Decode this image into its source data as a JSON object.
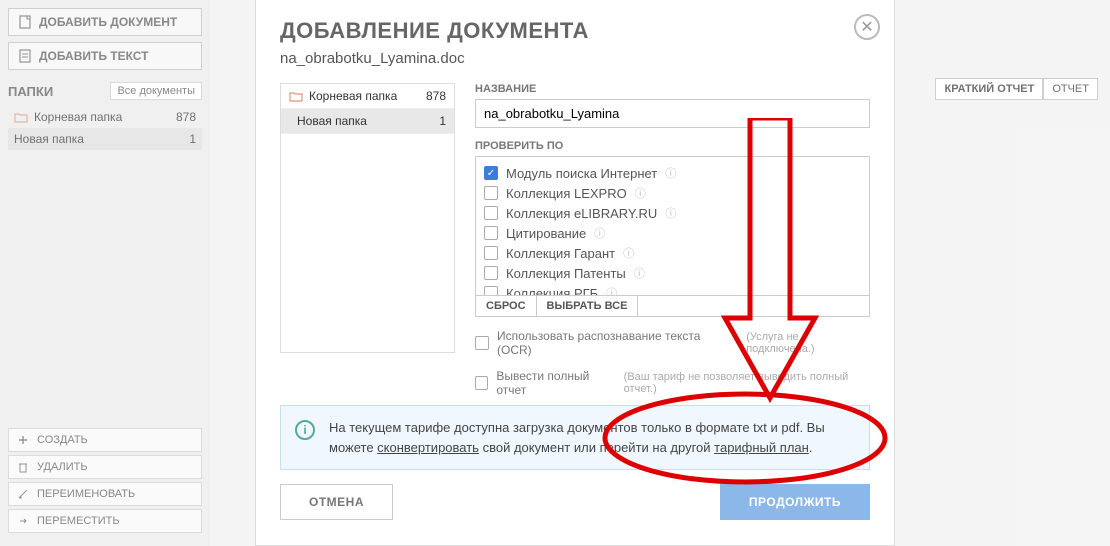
{
  "sidebar": {
    "add_doc": "ДОБАВИТЬ ДОКУМЕНТ",
    "add_text": "ДОБАВИТЬ ТЕКСТ",
    "folders_label": "ПАПКИ",
    "all_docs": "Все документы",
    "folders": [
      {
        "name": "Корневая папка",
        "count": "878"
      },
      {
        "name": "Новая папка",
        "count": "1"
      }
    ],
    "bottom": {
      "create": "СОЗДАТЬ",
      "delete": "УДАЛИТЬ",
      "rename": "ПЕРЕИМЕНОВАТЬ",
      "move": "ПЕРЕМЕСТИТЬ"
    }
  },
  "bg_right": {
    "tab_short": "КРАТКИЙ ОТЧЕТ",
    "tab_report": "ОТЧЕТ"
  },
  "modal": {
    "title": "ДОБАВЛЕНИЕ ДОКУМЕНТА",
    "subtitle": "na_obrabotku_Lyamina.doc",
    "tree": {
      "root": {
        "name": "Корневая папка",
        "count": "878"
      },
      "child": {
        "name": "Новая папка",
        "count": "1"
      }
    },
    "name_label": "НАЗВАНИЕ",
    "name_value": "na_obrabotku_Lyamina",
    "check_label": "ПРОВЕРИТЬ ПО",
    "checks": [
      {
        "label": "Модуль поиска Интернет",
        "checked": true
      },
      {
        "label": "Коллекция LEXPRO",
        "checked": false
      },
      {
        "label": "Коллекция eLIBRARY.RU",
        "checked": false
      },
      {
        "label": "Цитирование",
        "checked": false
      },
      {
        "label": "Коллекция Гарант",
        "checked": false
      },
      {
        "label": "Коллекция Патенты",
        "checked": false
      },
      {
        "label": "Коллекция РГБ",
        "checked": false
      }
    ],
    "reset": "СБРОС",
    "select_all": "ВЫБРАТЬ ВСЕ",
    "ocr_label": "Использовать распознавание текста (OCR)",
    "ocr_note": "(Услуга не подключена.)",
    "full_label": "Вывести полный отчет",
    "full_note": "(Ваш тариф не позволяет выводить полный отчет.)",
    "info_text_1": "На текущем тарифе доступна загрузка документов только в формате txt и pdf. Вы можете ",
    "info_link_1": "сконвертировать",
    "info_text_2": " свой документ или перейти на другой ",
    "info_link_2": "тарифный план",
    "info_text_3": ".",
    "cancel": "ОТМЕНА",
    "continue": "ПРОДОЛЖИТЬ"
  }
}
